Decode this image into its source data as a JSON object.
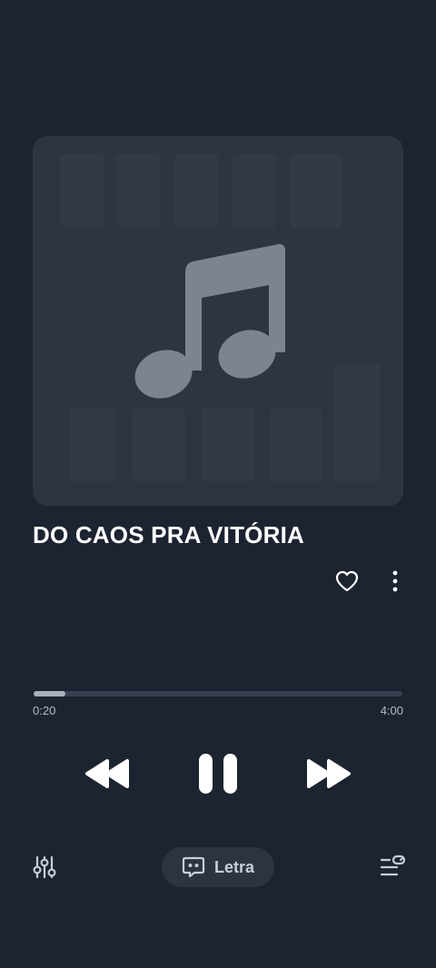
{
  "player": {
    "title": "DO CAOS PRA VITÓRIA",
    "artwork_icon": "music-note-icon",
    "progress_fraction": 0.085,
    "current_time": "0:20",
    "total_time": "4:00",
    "lyrics_label": "Letra"
  },
  "icons": {
    "like": "heart-outline-icon",
    "more": "more-vertical-icon",
    "previous": "rewind-icon",
    "pause": "pause-icon",
    "next": "fast-forward-icon",
    "equalizer": "sliders-icon",
    "lyrics": "lyrics-bubble-icon",
    "queue": "queue-icon"
  },
  "colors": {
    "background": "#1d2431",
    "artwork_bg": "#2d3542",
    "note": "#7c8492",
    "progress_fill": "#a9b0bc",
    "progress_track": "#384050"
  }
}
